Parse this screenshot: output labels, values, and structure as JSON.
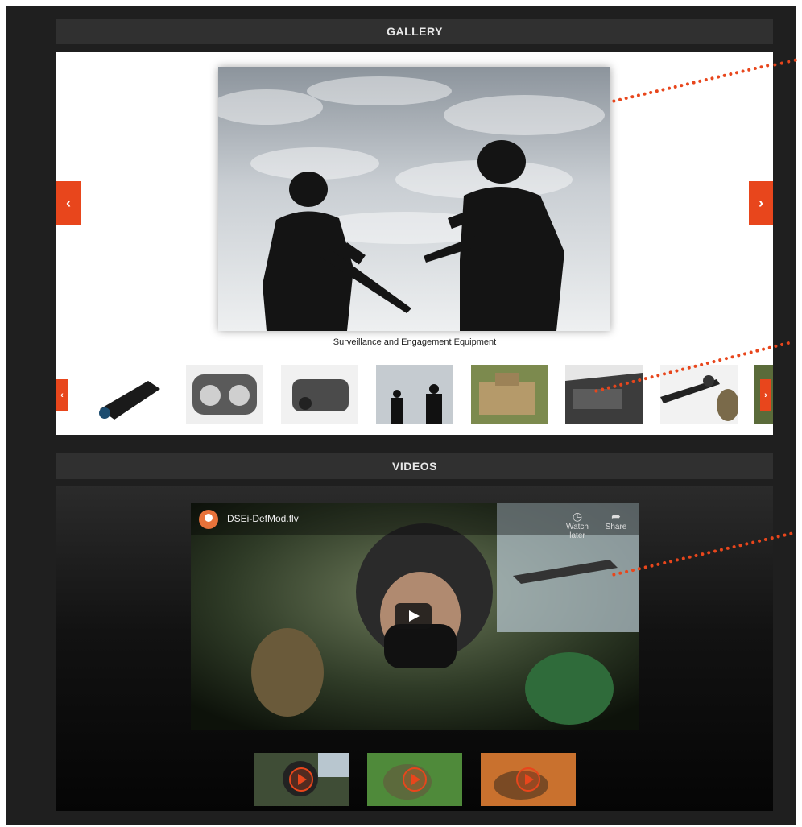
{
  "gallery": {
    "header": "GALLERY",
    "caption": "Surveillance and Engagement Equipment",
    "prev_label": "‹",
    "next_label": "›",
    "thumb_prev_label": "‹",
    "thumb_next_label": "›",
    "thumbnails": [
      "night-vision-scope",
      "thermal-binoculars",
      "binoculars",
      "soldiers-silhouette",
      "armored-vehicle",
      "concealed-position",
      "sniper-rifle",
      "partial-thumbnail"
    ]
  },
  "videos": {
    "header": "VIDEOS",
    "video_title": "DSEi-DefMod.flv",
    "watch_later_label": "Watch later",
    "share_label": "Share",
    "thumbnails": [
      "helicopter-pilot",
      "soldier-field",
      "soldier-desert"
    ]
  },
  "colors": {
    "accent": "#e8461c",
    "background": "#1f1f1f",
    "header_bar": "#303030"
  }
}
